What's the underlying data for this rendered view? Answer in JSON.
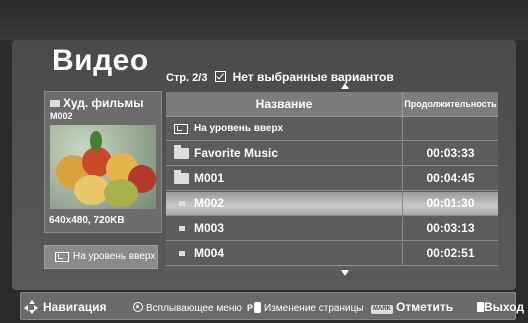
{
  "header": {
    "title": "Видео",
    "page_info": "Стр. 2/3",
    "selection_message": "Нет выбранные вариантов"
  },
  "info_panel": {
    "category": "Худ. фильмы",
    "item_name": "M002",
    "resolution": "640x480, 720KB",
    "up_button_label": "На уровень вверх"
  },
  "list": {
    "columns": {
      "name": "Название",
      "duration": "Продолжительность"
    },
    "rows": [
      {
        "type": "up",
        "name": "На уровень вверх",
        "duration": ""
      },
      {
        "type": "folder",
        "name": "Favorite Music",
        "duration": "00:03:33"
      },
      {
        "type": "folder",
        "name": "M001",
        "duration": "00:04:45"
      },
      {
        "type": "file",
        "name": "M002",
        "duration": "00:01:30",
        "selected": true
      },
      {
        "type": "file",
        "name": "M003",
        "duration": "00:03:13"
      },
      {
        "type": "file",
        "name": "M004",
        "duration": "00:02:51"
      }
    ]
  },
  "footer": {
    "navigation": "Навигация",
    "popup_menu": "Всплывающее меню",
    "page_change": "Изменение страницы",
    "page_key": "P",
    "mark_key": "MARK",
    "mark": "Отметить",
    "exit": "Выход"
  },
  "icons": {
    "folder": "folder-icon",
    "file": "file-icon",
    "up_level": "up-level-icon",
    "nav": "navigation-icon",
    "ok": "ok-button-icon",
    "page": "page-button-icon",
    "mark": "mark-button-icon",
    "exit": "exit-button-icon"
  }
}
